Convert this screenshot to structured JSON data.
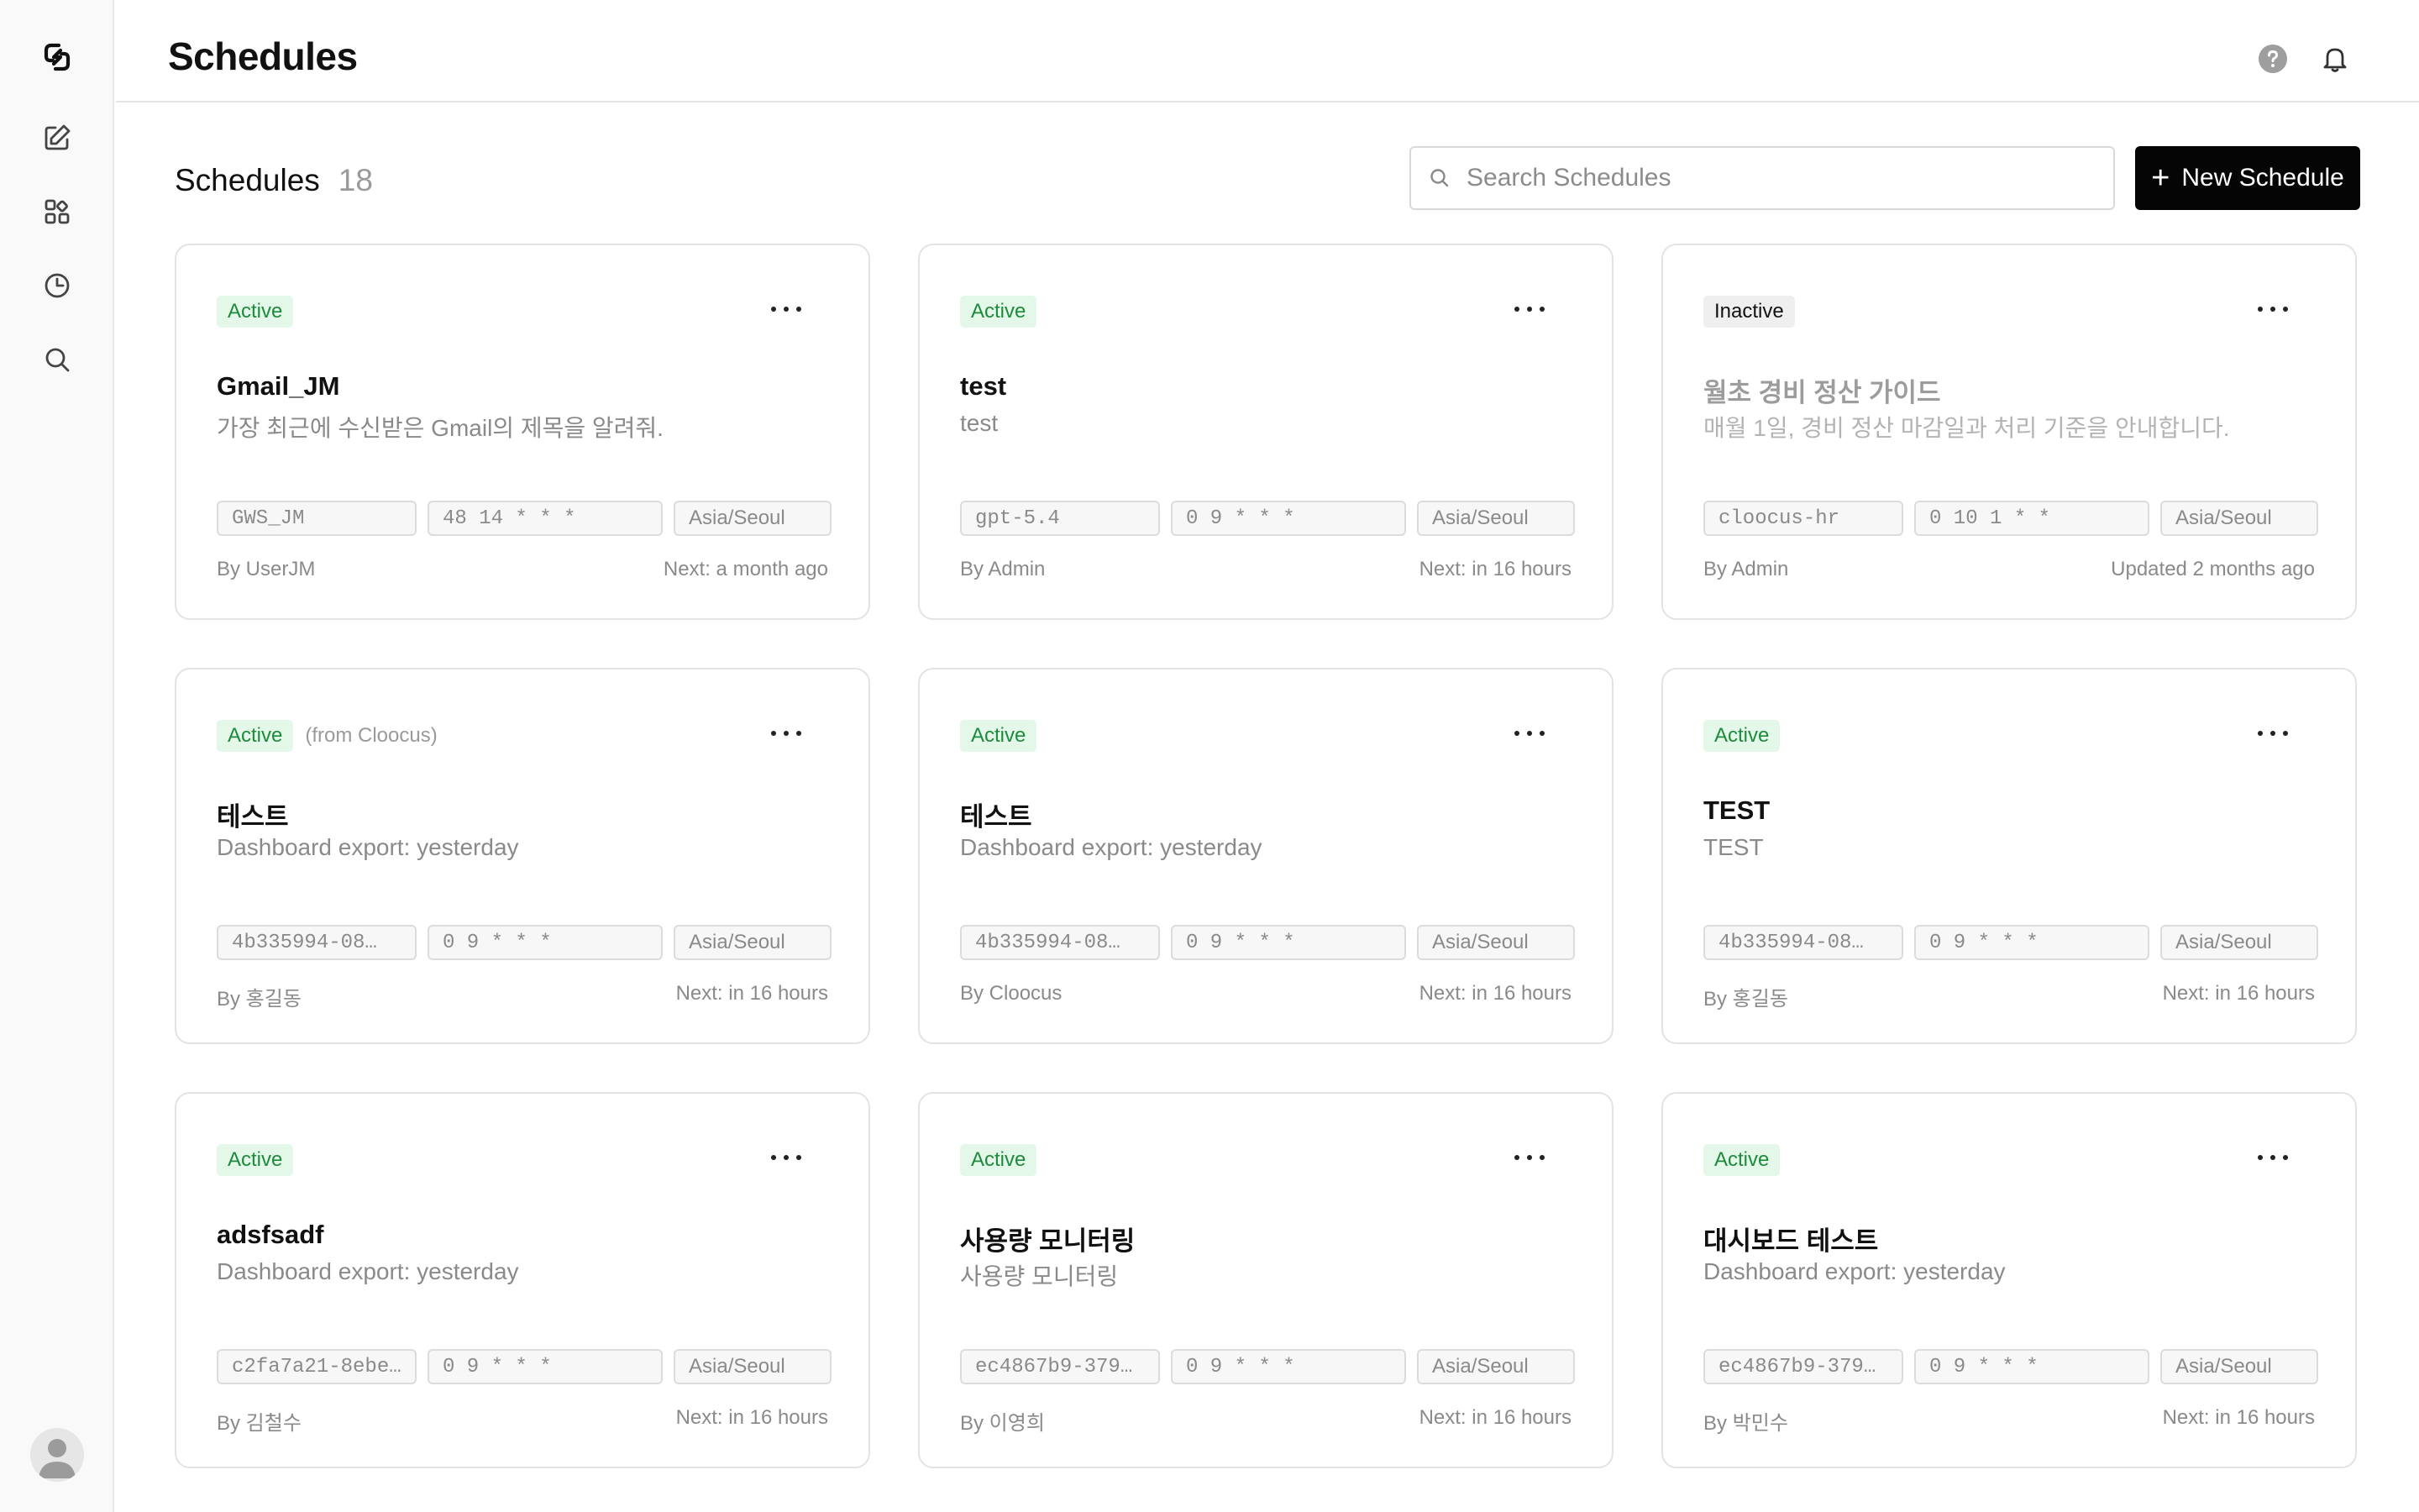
{
  "app": {
    "page_title": "Schedules"
  },
  "header": {
    "help_icon": "help-circle-icon",
    "notification_icon": "bell-icon"
  },
  "sidebar": {
    "items": [
      {
        "icon": "app-logo-icon"
      },
      {
        "icon": "edit-icon"
      },
      {
        "icon": "apps-icon"
      },
      {
        "icon": "clock-icon"
      },
      {
        "icon": "search-icon"
      }
    ],
    "avatar_icon": "user-avatar-icon"
  },
  "toolbar": {
    "title": "Schedules",
    "count": "18",
    "search_placeholder": "Search Schedules",
    "new_button_label": "New Schedule"
  },
  "colors": {
    "accent": "#050505",
    "active_badge_bg": "#e4f8e9",
    "active_badge_text": "#1e8a3d",
    "inactive_badge_bg": "#efefef"
  },
  "cards": [
    {
      "status": "Active",
      "source": "",
      "title": "Gmail_JM",
      "description": "가장 최근에 수신받은 Gmail의 제목을 알려줘.",
      "model": "GWS_JM",
      "cron": "48 14 * * *",
      "timezone": "Asia/Seoul",
      "author": "By UserJM",
      "next": "Next: a month ago"
    },
    {
      "status": "Active",
      "source": "",
      "title": "test",
      "description": "test",
      "model": "gpt-5.4",
      "cron": "0 9 * * *",
      "timezone": "Asia/Seoul",
      "author": "By Admin",
      "next": "Next: in 16 hours"
    },
    {
      "status": "Inactive",
      "source": "",
      "title": "월초 경비 정산 가이드",
      "description": "매월 1일, 경비 정산 마감일과 처리 기준을 안내합니다.",
      "model": "cloocus-hr",
      "cron": "0 10 1 * *",
      "timezone": "Asia/Seoul",
      "author": "By Admin",
      "next": "Updated 2 months ago"
    },
    {
      "status": "Active",
      "source": "(from Cloocus)",
      "title": "테스트",
      "description": "Dashboard export: yesterday",
      "model": "4b335994-08…",
      "cron": "0 9 * * *",
      "timezone": "Asia/Seoul",
      "author": "By 홍길동",
      "next": "Next: in 16 hours"
    },
    {
      "status": "Active",
      "source": "",
      "title": "테스트",
      "description": "Dashboard export: yesterday",
      "model": "4b335994-08…",
      "cron": "0 9 * * *",
      "timezone": "Asia/Seoul",
      "author": "By Cloocus",
      "next": "Next: in 16 hours"
    },
    {
      "status": "Active",
      "source": "",
      "title": "TEST",
      "description": "TEST",
      "model": "4b335994-08…",
      "cron": "0 9 * * *",
      "timezone": "Asia/Seoul",
      "author": "By 홍길동",
      "next": "Next: in 16 hours"
    },
    {
      "status": "Active",
      "source": "",
      "title": "adsfsadf",
      "description": "Dashboard export: yesterday",
      "model": "c2fa7a21-8ebe-…",
      "cron": "0 9 * * *",
      "timezone": "Asia/Seoul",
      "author": "By 김철수",
      "next": "Next: in 16 hours"
    },
    {
      "status": "Active",
      "source": "",
      "title": "사용량 모니터링",
      "description": "사용량 모니터링",
      "model": "ec4867b9-379…",
      "cron": "0 9 * * *",
      "timezone": "Asia/Seoul",
      "author": "By 이영희",
      "next": "Next: in 16 hours"
    },
    {
      "status": "Active",
      "source": "",
      "title": "대시보드 테스트",
      "description": "Dashboard export: yesterday",
      "model": "ec4867b9-379…",
      "cron": "0 9 * * *",
      "timezone": "Asia/Seoul",
      "author": "By 박민수",
      "next": "Next: in 16 hours"
    }
  ]
}
